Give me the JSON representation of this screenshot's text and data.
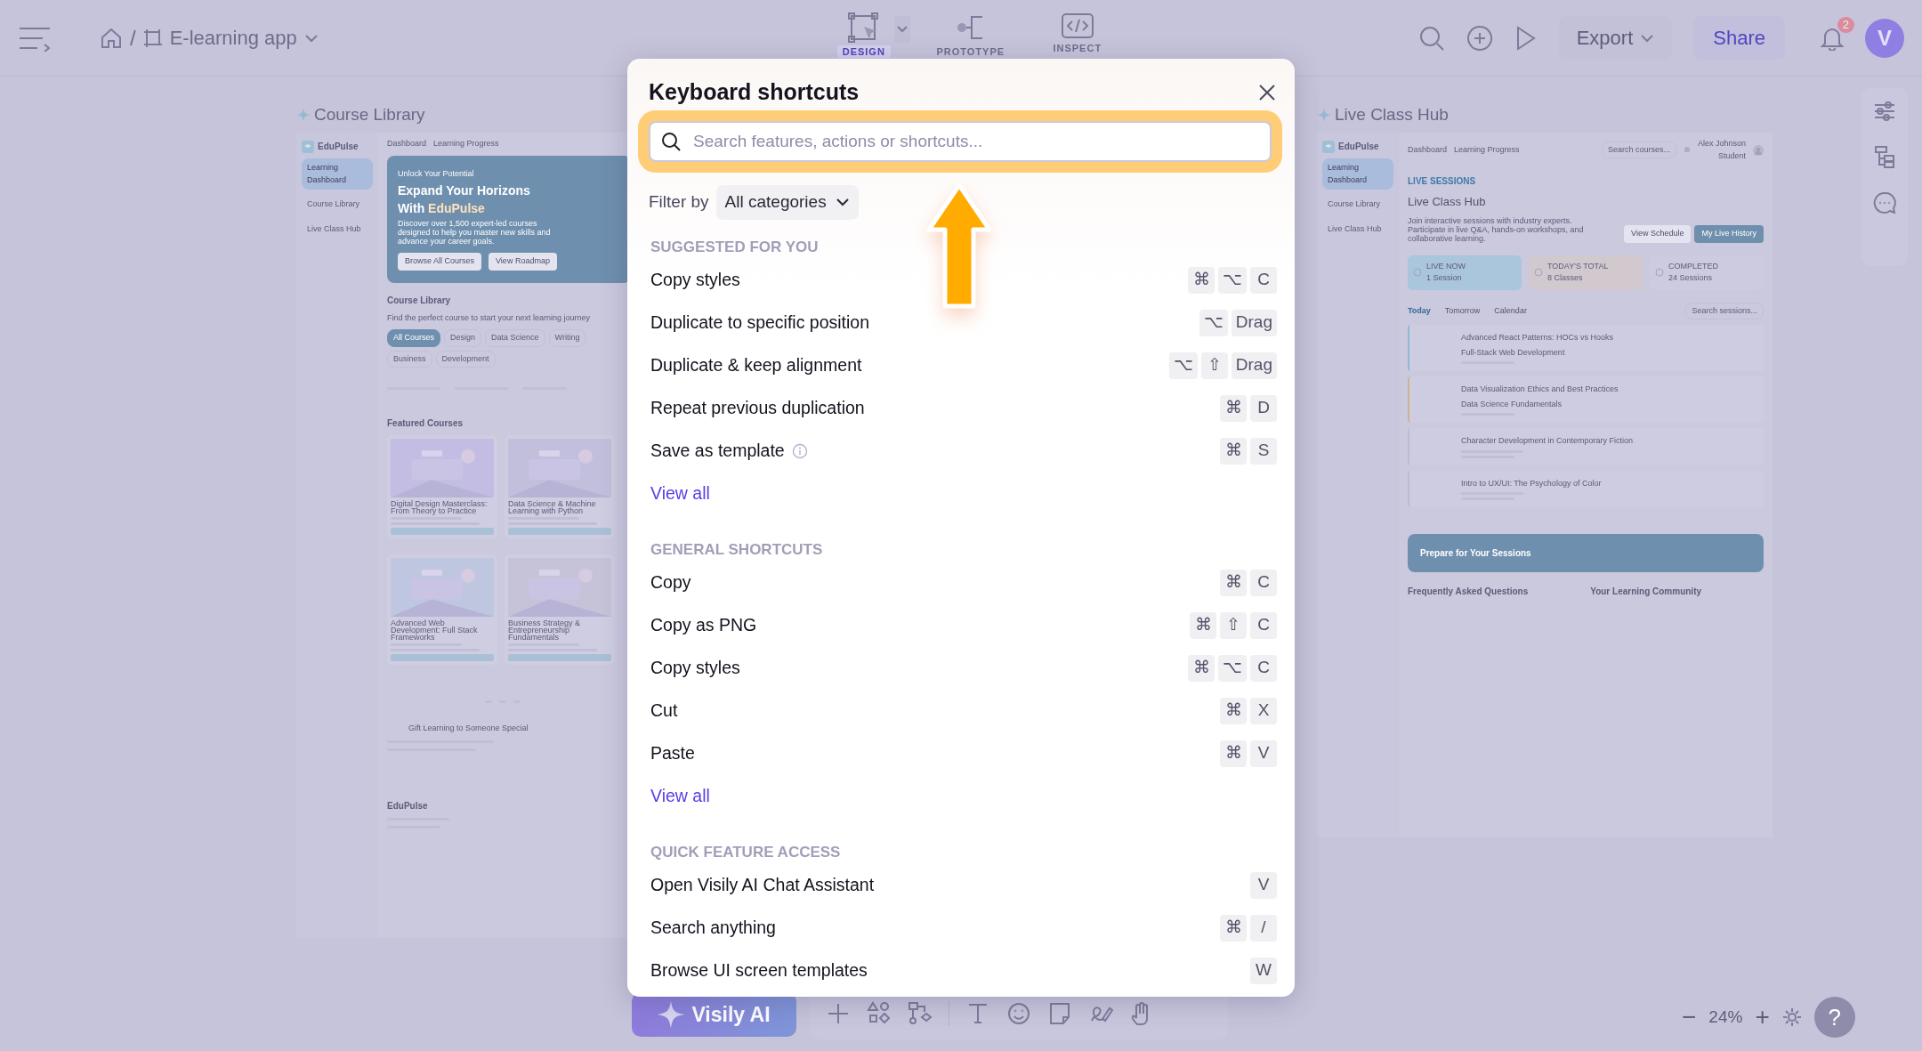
{
  "topbar": {
    "separator": "/",
    "project": "E-learning app",
    "modes": [
      {
        "kind": "design",
        "label": "DESIGN",
        "selected": true
      },
      {
        "kind": "prototype",
        "label": "PROTOTYPE",
        "selected": false
      },
      {
        "kind": "inspect",
        "label": "INSPECT",
        "selected": false
      }
    ],
    "export": "Export",
    "share": "Share",
    "notifications": "2",
    "avatar": "V"
  },
  "course_library_frame": {
    "title": "Course Library",
    "brand": "EduPulse",
    "nav": [
      {
        "label": "Learning Dashboard",
        "selected": true
      },
      {
        "label": "Course Library",
        "selected": false
      },
      {
        "label": "Live Class Hub",
        "selected": false
      }
    ],
    "breadcrumb": [
      "Dashboard",
      "Learning Progress"
    ],
    "hero": {
      "eyebrow": "Unlock Your Potential",
      "heading": "Expand Your Horizons",
      "heading_2": "With",
      "heading_accent": "EduPulse",
      "text": "Discover over 1,500 expert-led courses designed to help you master new skills and advance your career goals.",
      "buttons": [
        "Browse All Courses",
        "View Roadmap"
      ]
    },
    "section": {
      "heading": "Course Library",
      "subtitle": "Find the perfect course to start your next learning journey"
    },
    "chips": [
      {
        "label": "All Courses",
        "selected": true
      },
      {
        "label": "Design",
        "selected": false
      },
      {
        "label": "Data Science",
        "selected": false
      },
      {
        "label": "Writing",
        "selected": false
      },
      {
        "label": "Business",
        "selected": false
      },
      {
        "label": "Development",
        "selected": false
      }
    ],
    "featured": "Featured Courses",
    "courses": [
      {
        "title": "Digital Design Masterclass: From Theory to Practice"
      },
      {
        "title": "Data Science & Machine Learning with Python"
      },
      {
        "title": "Advanced Web Development: Full Stack Frameworks"
      },
      {
        "title": "Business Strategy & Entrepreneurship Fundamentals"
      }
    ],
    "gift": "Gift Learning to Someone Special",
    "footer_brand": "EduPulse"
  },
  "live_class_frame": {
    "title": "Live Class Hub",
    "brand": "EduPulse",
    "nav": [
      {
        "label": "Learning Dashboard",
        "selected": true
      },
      {
        "label": "Course Library",
        "selected": false
      },
      {
        "label": "Live Class Hub",
        "selected": false
      }
    ],
    "breadcrumb": [
      "Dashboard",
      "Learning Progress"
    ],
    "search_placeholder": "Search courses...",
    "user": "Alex Johnson",
    "role": "Student",
    "eyebrow": "LIVE SESSIONS",
    "heading": "Live Class Hub",
    "text": "Join interactive sessions with industry experts. Participate in live Q&A, hands-on workshops, and collaborative learning.",
    "buttons": [
      {
        "label": "View Schedule",
        "primary": false
      },
      {
        "label": "My Live History",
        "primary": true
      }
    ],
    "stats": [
      {
        "label": "LIVE NOW",
        "value": "1 Session",
        "color": "#a9c6dc"
      },
      {
        "label": "TODAY'S TOTAL",
        "value": "8 Classes",
        "color": "#d2c9cf"
      },
      {
        "label": "COMPLETED",
        "value": "24 Sessions",
        "color": "#cdcbe0"
      }
    ],
    "tabs": [
      {
        "label": "Today",
        "selected": true
      },
      {
        "label": "Tomorrow",
        "selected": false
      },
      {
        "label": "Calendar",
        "selected": false
      }
    ],
    "session_search": "Search sessions...",
    "sessions": [
      {
        "title": "Advanced React Patterns: HOCs vs Hooks",
        "course": "Full-Stack Web Development",
        "color": "#8fb8d4"
      },
      {
        "title": "Data Visualization Ethics and Best Practices",
        "course": "Data Science Fundamentals",
        "color": "#c9b48f"
      },
      {
        "title": "Character Development in Contemporary Fiction",
        "color": "#bdbbd2"
      },
      {
        "title": "Intro to UX/UI: The Psychology of Color",
        "color": "#bdbbd2"
      }
    ],
    "banner": "Prepare for Your Sessions",
    "faq": "Frequently Asked Questions",
    "community": "Your Learning Community"
  },
  "dialog": {
    "title": "Keyboard shortcuts",
    "search": {
      "placeholder": "Search features, actions or shortcuts..."
    },
    "filter_label": "Filter by",
    "filter_value": "All categories",
    "sections": [
      {
        "heading": "SUGGESTED FOR YOU",
        "items": [
          {
            "label": "Copy styles",
            "keys": [
              "⌘",
              "⌥",
              "C"
            ],
            "info": false
          },
          {
            "label": "Duplicate to specific position",
            "keys": [
              "⌥",
              "Drag"
            ],
            "info": false
          },
          {
            "label": "Duplicate & keep alignment",
            "keys": [
              "⌥",
              "⇧",
              "Drag"
            ],
            "info": false
          },
          {
            "label": "Repeat previous duplication",
            "keys": [
              "⌘",
              "D"
            ],
            "info": false
          },
          {
            "label": "Save as template",
            "keys": [
              "⌘",
              "S"
            ],
            "info": true
          }
        ],
        "link": "View all"
      },
      {
        "heading": "GENERAL SHORTCUTS",
        "items": [
          {
            "label": "Copy",
            "keys": [
              "⌘",
              "C"
            ],
            "info": false
          },
          {
            "label": "Copy as PNG",
            "keys": [
              "⌘",
              "⇧",
              "C"
            ],
            "info": false
          },
          {
            "label": "Copy styles",
            "keys": [
              "⌘",
              "⌥",
              "C"
            ],
            "info": false
          },
          {
            "label": "Cut",
            "keys": [
              "⌘",
              "X"
            ],
            "info": false
          },
          {
            "label": "Paste",
            "keys": [
              "⌘",
              "V"
            ],
            "info": false
          }
        ],
        "link": "View all"
      },
      {
        "heading": "QUICK FEATURE ACCESS",
        "items": [
          {
            "label": "Open Visily AI Chat Assistant",
            "keys": [
              "V"
            ],
            "info": false
          },
          {
            "label": "Search anything",
            "keys": [
              "⌘",
              "/"
            ],
            "info": false
          },
          {
            "label": "Browse UI screen templates",
            "keys": [
              "W"
            ],
            "info": false
          }
        ]
      }
    ]
  },
  "bottom": {
    "ai_button": "Visily AI",
    "zoom": "24%",
    "zoom_out": "−",
    "zoom_in": "+",
    "help": "?"
  }
}
